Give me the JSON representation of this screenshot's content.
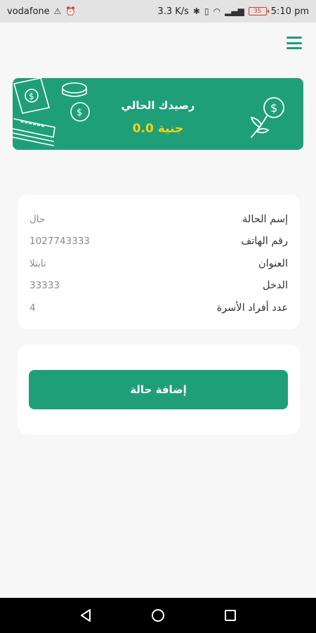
{
  "status_bar": {
    "carrier": "vodafone",
    "speed": "3.3 K/s",
    "battery": "35",
    "time": "5:10 pm"
  },
  "balance": {
    "title": "رصيدك الحالي",
    "amount": "0.0 جنية"
  },
  "case_info": {
    "rows": [
      {
        "label": "إسم الحالة",
        "value": "حال"
      },
      {
        "label": "رقم الهاتف",
        "value": "1027743333"
      },
      {
        "label": "العنوان",
        "value": "تابتلا"
      },
      {
        "label": "الدخل",
        "value": "33333"
      },
      {
        "label": "عدد أفراد الأسرة",
        "value": "4"
      }
    ]
  },
  "actions": {
    "add_case_label": "إضافة حالة"
  },
  "colors": {
    "primary": "#1f9f78",
    "amount": "#f3d21c",
    "background": "#f7f7f7"
  }
}
